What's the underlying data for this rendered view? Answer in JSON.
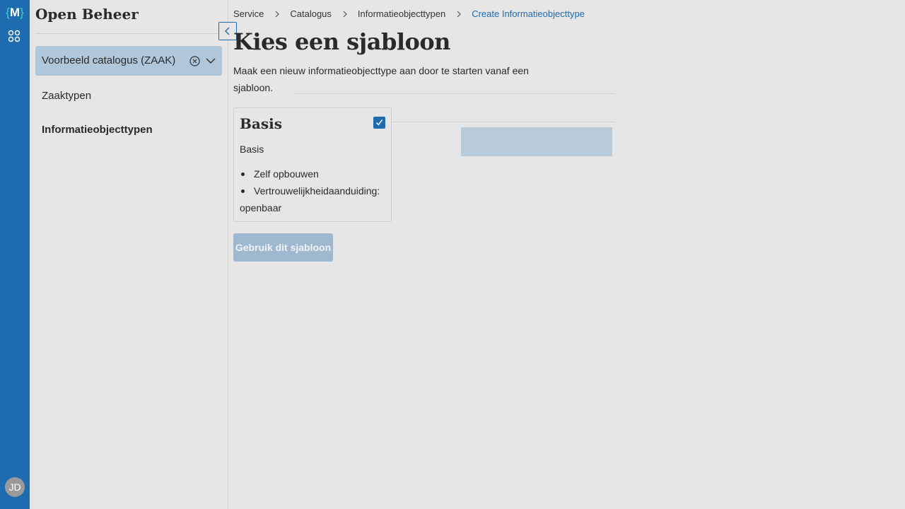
{
  "rail": {
    "logo_letter": "M",
    "logo_left": "{",
    "logo_right": "}",
    "avatar_initials": "JD"
  },
  "sidebar": {
    "app_title": "Open Beheer",
    "catalog_select": {
      "value": "Voorbeeld catalogus (ZAAK)"
    },
    "items": [
      {
        "label": "Zaaktypen"
      },
      {
        "label": "Informatieobjecttypen"
      }
    ]
  },
  "breadcrumb": [
    {
      "label": "Service"
    },
    {
      "label": "Catalogus"
    },
    {
      "label": "Informatieobjecttypen"
    },
    {
      "label": "Create Informatieobjecttype"
    }
  ],
  "main": {
    "title": "Kies een sjabloon",
    "intro": "Maak een nieuw informatieobjecttype aan door te starten vanaf een sjabloon.",
    "template_card": {
      "title": "Basis",
      "checked": true,
      "subtitle": "Basis",
      "bullets": [
        "Zelf opbouwen",
        "Vertrouwelijkheidaanduiding: openbaar"
      ]
    },
    "use_button": "Gebruik dit sjabloon"
  },
  "colors": {
    "rail": "#1f6bb0",
    "accent": "#1f6bb0",
    "select_bg": "#b0c7da",
    "button_disabled": "#9fb8cf",
    "background": "#e6e6e6"
  },
  "icons": {
    "apps": "grid-icon",
    "collapse": "chevron-left-icon",
    "clear": "clear-circle-icon",
    "dropdown": "chevron-down-icon",
    "breadcrumb_separator": "chevron-right-icon",
    "checkbox": "check-icon"
  }
}
